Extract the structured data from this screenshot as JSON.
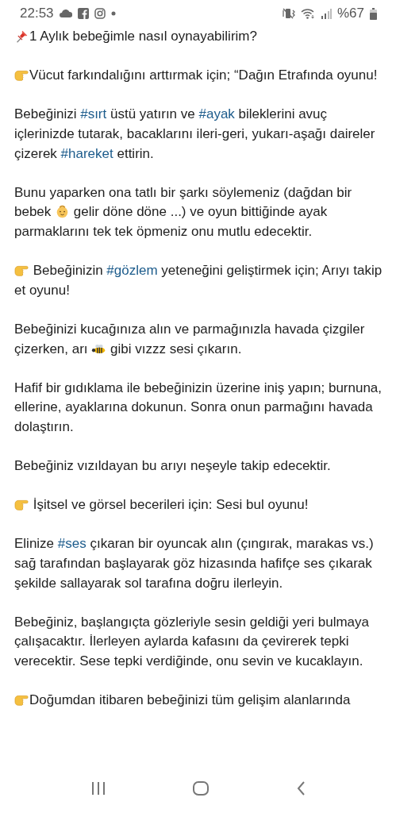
{
  "status_bar": {
    "time": "22:53",
    "battery_text": "%67"
  },
  "post": {
    "paragraphs": [
      [
        {
          "kind": "pin"
        },
        {
          "kind": "text",
          "text": "1 Aylık bebeğimle nasıl oynayabilirim?"
        }
      ],
      [
        {
          "kind": "hand"
        },
        {
          "kind": "text",
          "text": "Vücut farkındalığını arttırmak için; “Dağın Etrafında oyunu!"
        }
      ],
      [
        {
          "kind": "text",
          "text": "Bebeğinizi "
        },
        {
          "kind": "hashtag",
          "text": "#sırt"
        },
        {
          "kind": "text",
          "text": " üstü yatırın ve "
        },
        {
          "kind": "hashtag",
          "text": "#ayak"
        },
        {
          "kind": "text",
          "text": " bileklerini avuç içlerinizde tutarak, bacaklarını ileri-geri, yukarı-aşağı daireler çizerek "
        },
        {
          "kind": "hashtag",
          "text": "#hareket"
        },
        {
          "kind": "text",
          "text": " ettirin."
        }
      ],
      [
        {
          "kind": "text",
          "text": "Bunu yaparken ona tatlı bir şarkı söylemeniz (dağdan bir bebek "
        },
        {
          "kind": "baby"
        },
        {
          "kind": "text",
          "text": " gelir döne döne ...) ve oyun bittiğinde ayak parmaklarını tek tek öpmeniz onu mutlu edecektir."
        }
      ],
      [
        {
          "kind": "hand"
        },
        {
          "kind": "text",
          "text": " Bebeğinizin "
        },
        {
          "kind": "hashtag",
          "text": "#gözlem"
        },
        {
          "kind": "text",
          "text": " yeteneğini geliştirmek için; Arıyı takip et oyunu!"
        }
      ],
      [
        {
          "kind": "text",
          "text": "Bebeğinizi kucağınıza alın ve parmağınızla havada çizgiler çizerken, arı "
        },
        {
          "kind": "bee"
        },
        {
          "kind": "text",
          "text": " gibi vızzz sesi çıkarın."
        }
      ],
      [
        {
          "kind": "text",
          "text": "Hafif bir gıdıklama ile bebeğinizin üzerine iniş yapın; burnuna, ellerine, ayaklarına dokunun. Sonra onun parmağını havada dolaştırın."
        }
      ],
      [
        {
          "kind": "text",
          "text": "Bebeğiniz vızıldayan bu arıyı neşeyle takip edecektir."
        }
      ],
      [
        {
          "kind": "hand"
        },
        {
          "kind": "text",
          "text": " İşitsel ve görsel becerileri  için: Sesi bul oyunu!"
        }
      ],
      [
        {
          "kind": "text",
          "text": "Elinize "
        },
        {
          "kind": "hashtag",
          "text": "#ses"
        },
        {
          "kind": "text",
          "text": " çıkaran bir oyuncak alın (çıngırak, marakas vs.) sağ tarafından başlayarak göz hizasında hafifçe ses çıkarak şekilde sallayarak sol tarafına doğru ilerleyin."
        }
      ],
      [
        {
          "kind": "text",
          "text": "Bebeğiniz, başlangıçta gözleriyle sesin geldiği yeri bulmaya çalışacaktır. İlerleyen aylarda kafasını da çevirerek tepki verecektir. Sese tepki verdiğinde, onu sevin ve kucaklayın."
        }
      ],
      [
        {
          "kind": "hand"
        },
        {
          "kind": "text",
          "text": "Doğumdan itibaren bebeğinizi tüm gelişim alanlarında"
        }
      ]
    ]
  }
}
